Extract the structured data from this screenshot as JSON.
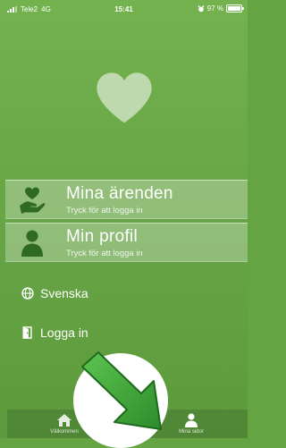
{
  "status_bar": {
    "carrier": "Tele2",
    "network": "4G",
    "time": "15:41",
    "battery": "97 %",
    "battery_level": 0.97
  },
  "hero": {
    "icon": "heart-icon"
  },
  "menu": [
    {
      "icon": "heart-hand-icon",
      "title": "Mina ärenden",
      "subtitle": "Tryck för att logga in"
    },
    {
      "icon": "person-icon",
      "title": "Min profil",
      "subtitle": "Tryck för att logga in"
    }
  ],
  "language": {
    "icon": "globe-icon",
    "label": "Svenska"
  },
  "login": {
    "icon": "door-icon",
    "label": "Logga in"
  },
  "tabbar": {
    "home_label": "Välkommen",
    "mine_label": "Mina sidor"
  },
  "colors": {
    "background": "#68a646",
    "arrow": "#3fa33a",
    "panel": "rgba(255,255,255,0.28)"
  }
}
